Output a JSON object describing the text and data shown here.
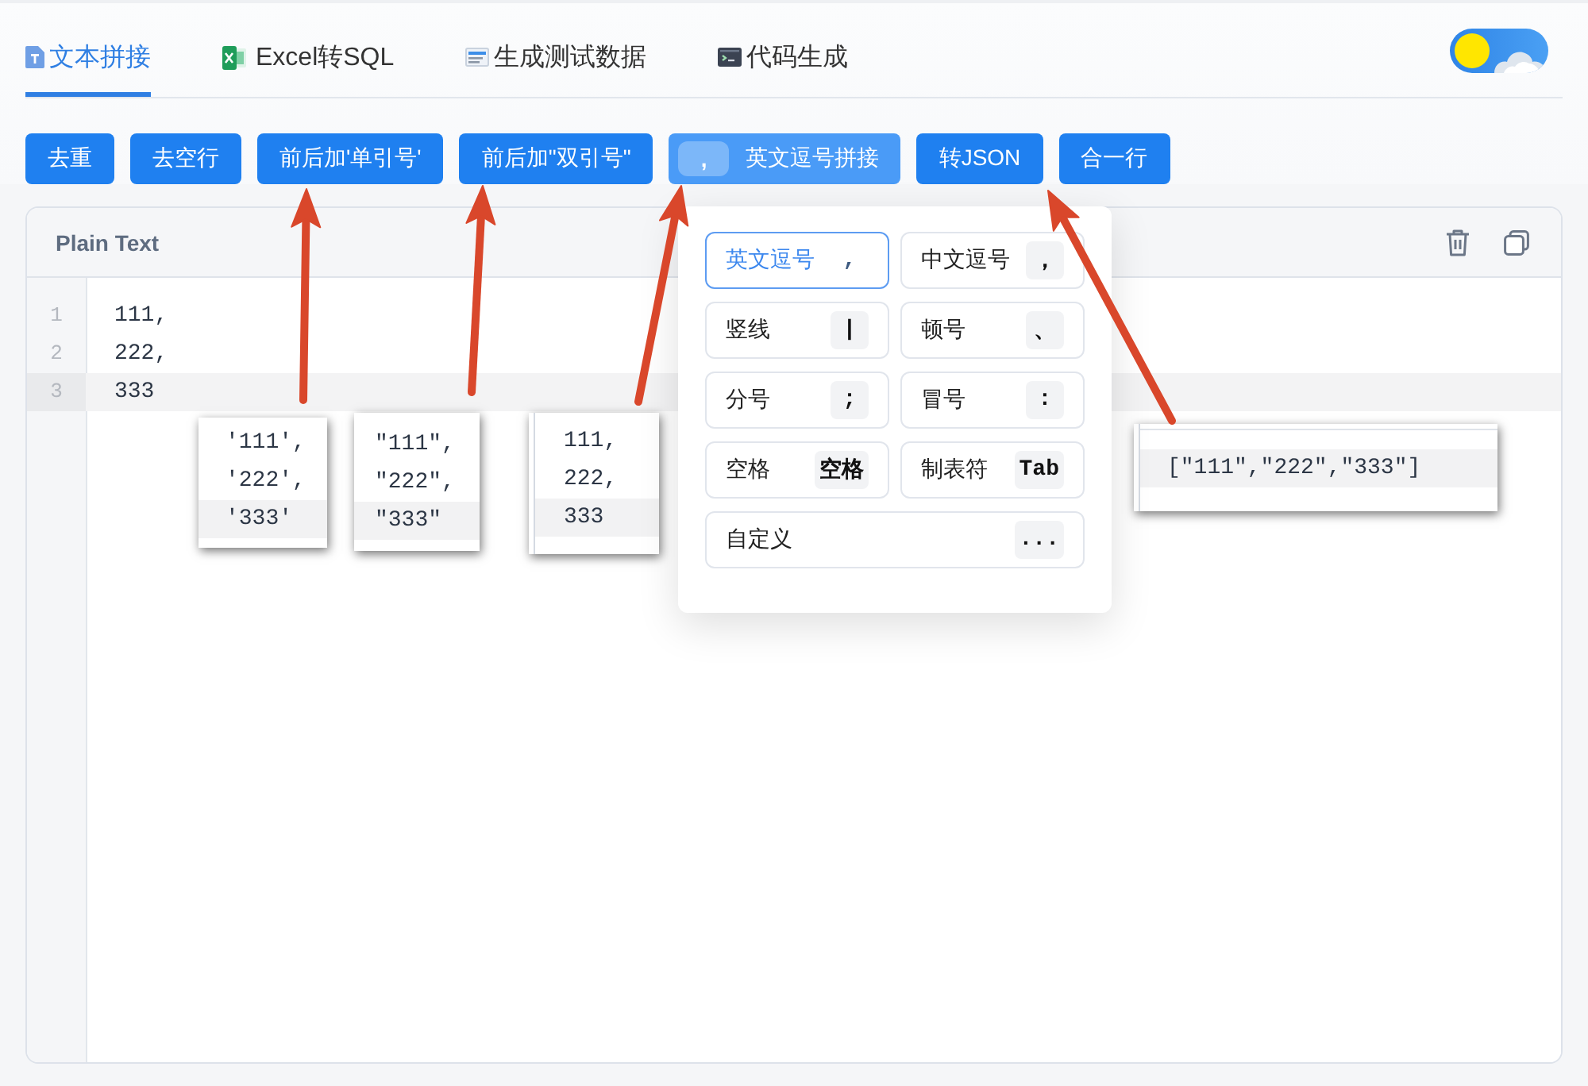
{
  "tabs": [
    {
      "label": "文本拼接",
      "selected": true
    },
    {
      "label": "Excel转SQL",
      "selected": false
    },
    {
      "label": "生成测试数据",
      "selected": false
    },
    {
      "label": "代码生成",
      "selected": false
    }
  ],
  "theme_toggle": {
    "dark": false
  },
  "toolbar": [
    {
      "kind": "button",
      "label": "去重"
    },
    {
      "kind": "button",
      "label": "去空行"
    },
    {
      "kind": "button",
      "label": "前后加'单引号'"
    },
    {
      "kind": "button",
      "label": "前后加\"双引号\""
    },
    {
      "kind": "split",
      "symbol": ",",
      "label": "英文逗号拼接",
      "expanded": true
    },
    {
      "kind": "button",
      "label": "转JSON"
    },
    {
      "kind": "button",
      "label": "合一行"
    }
  ],
  "editor": {
    "title": "Plain Text",
    "lines": [
      {
        "number": "1",
        "text": "111,",
        "current": false
      },
      {
        "number": "2",
        "text": "222,",
        "current": false
      },
      {
        "number": "3",
        "text": "333",
        "current": true
      }
    ]
  },
  "separator_menu": {
    "options": [
      {
        "label": "英文逗号",
        "symbol": ",",
        "selected": true
      },
      {
        "label": "中文逗号",
        "symbol": "，",
        "selected": false
      },
      {
        "label": "竖线",
        "symbol": "|",
        "selected": false
      },
      {
        "label": "顿号",
        "symbol": "、",
        "selected": false
      },
      {
        "label": "分号",
        "symbol": ";",
        "selected": false
      },
      {
        "label": "冒号",
        "symbol": ":",
        "selected": false
      },
      {
        "label": "空格",
        "symbol": "空格",
        "selected": false
      },
      {
        "label": "制表符",
        "symbol": "Tab",
        "selected": false
      },
      {
        "label": "自定义",
        "symbol": "...",
        "selected": false
      }
    ]
  },
  "annotations": [
    {
      "kind": "plain",
      "lines": [
        {
          "text": "'111',",
          "current": false
        },
        {
          "text": "'222',",
          "current": false
        },
        {
          "text": "'333'",
          "current": true
        }
      ]
    },
    {
      "kind": "plain",
      "lines": [
        {
          "text": "\"111\",",
          "current": false
        },
        {
          "text": "\"222\",",
          "current": false
        },
        {
          "text": "\"333\"",
          "current": true
        }
      ]
    },
    {
      "kind": "gutter",
      "lines": [
        {
          "text": "111,",
          "current": false
        },
        {
          "text": "222,",
          "current": false
        },
        {
          "text": "333",
          "current": true
        }
      ]
    },
    {
      "kind": "gutter",
      "lines": [
        {
          "text": "[\"111\",\"222\",\"333\"]",
          "current": true
        }
      ]
    }
  ]
}
